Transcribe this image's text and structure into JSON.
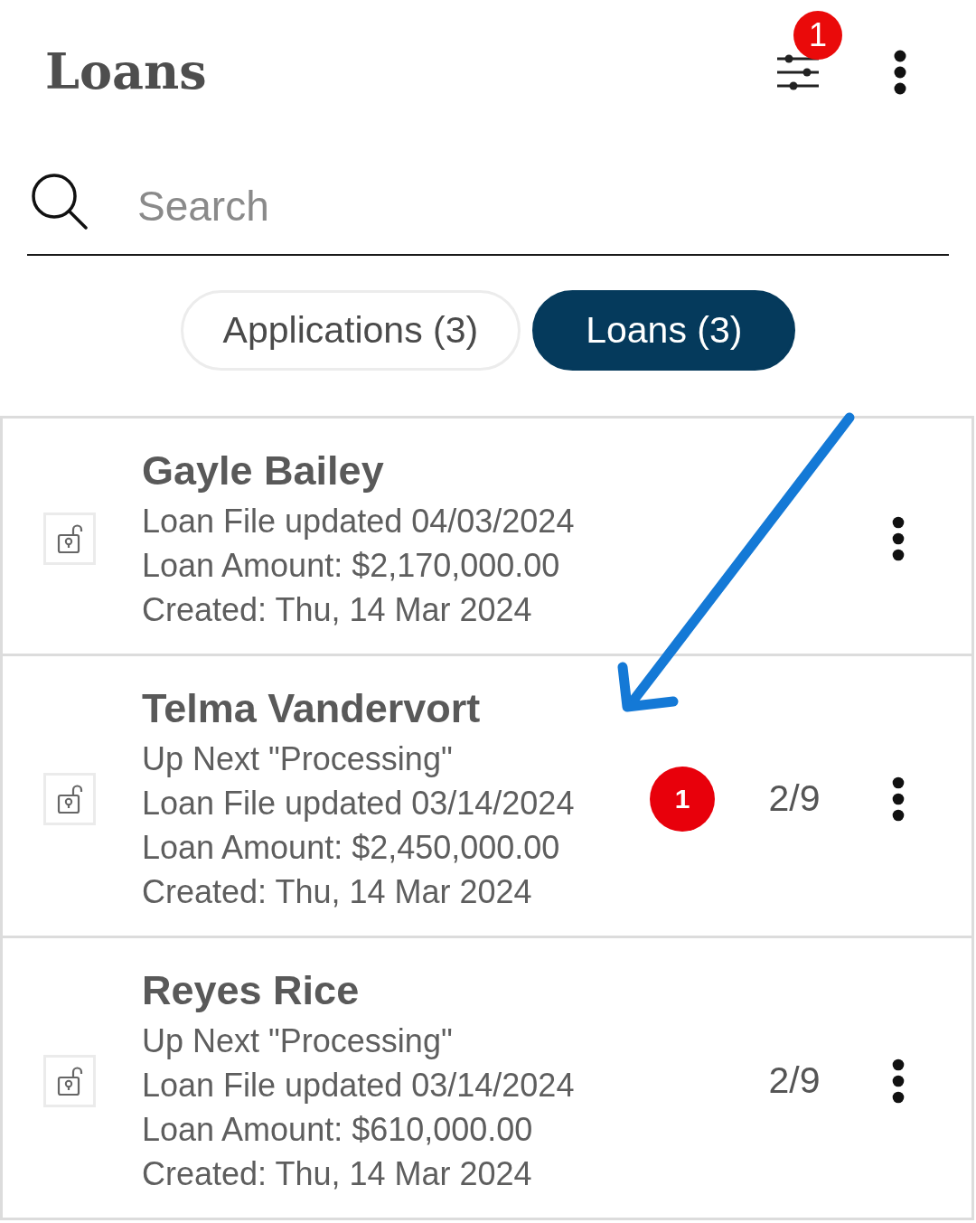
{
  "header": {
    "title": "Loans",
    "filter_badge": "1"
  },
  "search": {
    "placeholder": "Search"
  },
  "tabs": [
    {
      "label": "Applications (3)",
      "selected": false
    },
    {
      "label": "Loans (3)",
      "selected": true
    }
  ],
  "loans": [
    {
      "name": "Gayle Bailey",
      "details": [
        "Loan File updated 04/03/2024",
        "Loan Amount: $2,170,000.00",
        "Created: Thu, 14 Mar 2024"
      ]
    },
    {
      "name": "Telma Vandervort",
      "details": [
        "Up Next \"Processing\"",
        "Loan File updated 03/14/2024",
        "Loan Amount: $2,450,000.00",
        "Created: Thu, 14 Mar 2024"
      ],
      "badge": "1",
      "progress": "2/9"
    },
    {
      "name": "Reyes Rice",
      "details": [
        "Up Next \"Processing\"",
        "Loan File updated 03/14/2024",
        "Loan Amount: $610,000.00",
        "Created: Thu, 14 Mar 2024"
      ],
      "progress": "2/9"
    }
  ]
}
